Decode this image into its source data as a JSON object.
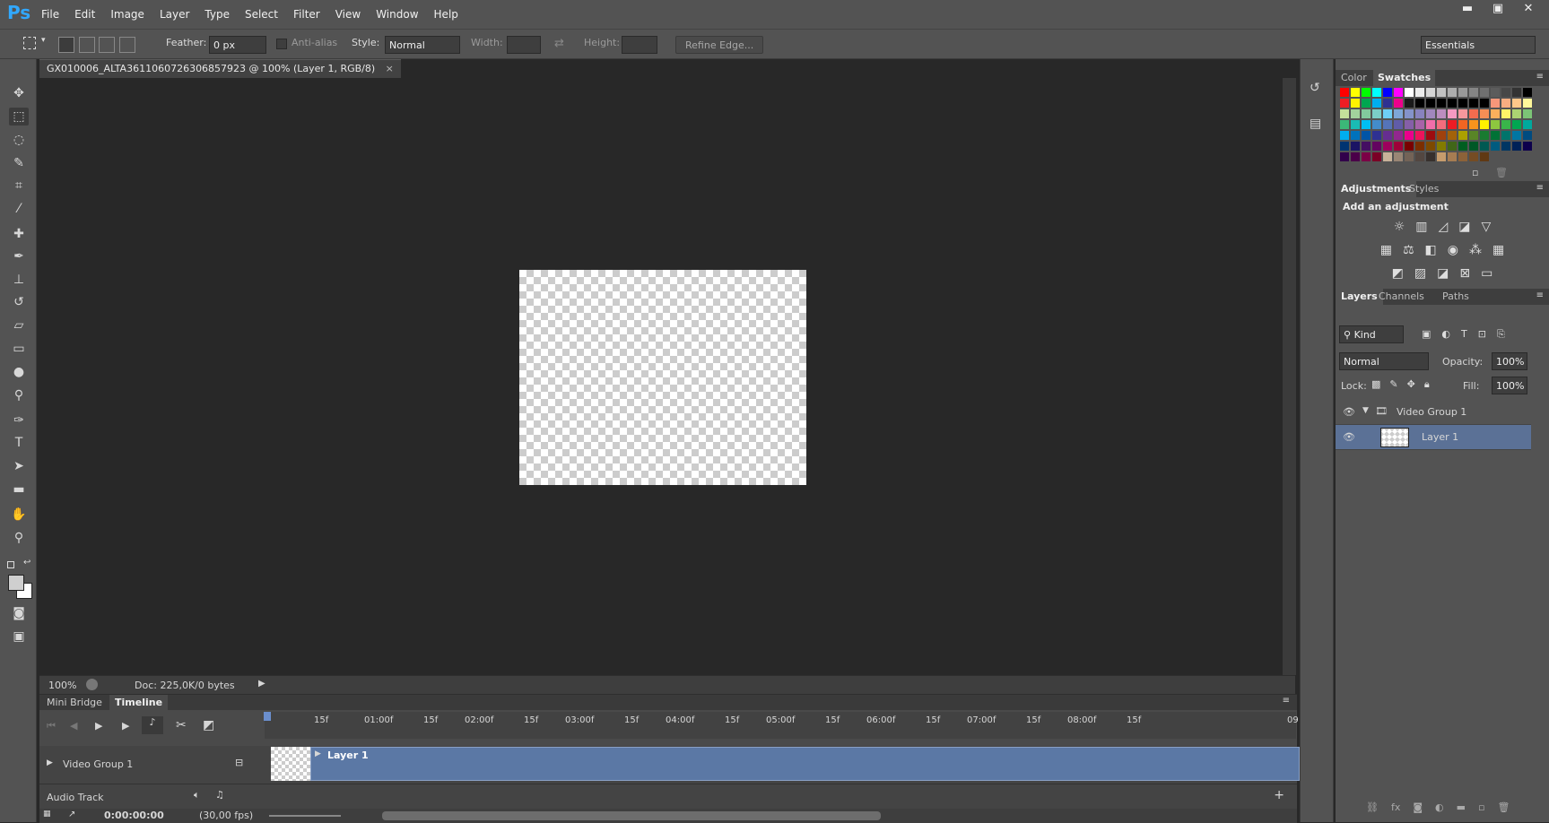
{
  "app": {
    "logo": "Ps"
  },
  "menu": [
    "File",
    "Edit",
    "Image",
    "Layer",
    "Type",
    "Select",
    "Filter",
    "View",
    "Window",
    "Help"
  ],
  "window_controls": {
    "minimize": "▬",
    "maximize": "▣",
    "close": "✕"
  },
  "options": {
    "feather_label": "Feather:",
    "feather_value": "0 px",
    "antialias_label": "Anti-alias",
    "style_label": "Style:",
    "style_value": "Normal",
    "width_label": "Width:",
    "height_label": "Height:",
    "refine_label": "Refine Edge...",
    "workspace": "Essentials"
  },
  "document": {
    "tab_title": "GX010006_ALTA3611060726306857923 @ 100% (Layer 1, RGB/8)",
    "close": "×"
  },
  "status": {
    "zoom": "100%",
    "doc": "Doc: 225,0K/0 bytes"
  },
  "timeline": {
    "tabs": [
      "Mini Bridge",
      "Timeline"
    ],
    "ticks": [
      "15f",
      "01:00f",
      "15f",
      "02:00f",
      "15f",
      "03:00f",
      "15f",
      "04:00f",
      "15f",
      "05:00f",
      "15f",
      "06:00f",
      "15f",
      "07:00f",
      "15f",
      "08:00f",
      "15f",
      "09"
    ],
    "group_name": "Video Group 1",
    "clip_name": "Layer 1",
    "audio_track": "Audio Track",
    "timecode": "0:00:00:00",
    "fps": "(30,00 fps)"
  },
  "panels": {
    "color_tabs": [
      "Color",
      "Swatches"
    ],
    "swatch_colors": [
      "#ff0000",
      "#ffff00",
      "#00ff00",
      "#00ffff",
      "#0000ff",
      "#ff00ff",
      "#ffffff",
      "#ebebeb",
      "#d6d6d6",
      "#c2c2c2",
      "#adadad",
      "#999999",
      "#858585",
      "#707070",
      "#5c5c5c",
      "#474747",
      "#333333",
      "#000000",
      "#ee1d24",
      "#fff200",
      "#00a650",
      "#00aeef",
      "#2e3192",
      "#ec008c",
      "#1a1a1a",
      "#000000",
      "#000000",
      "#000000",
      "#000000",
      "#000000",
      "#000000",
      "#000000",
      "#f7977a",
      "#f9ad81",
      "#fdc68a",
      "#fff79a",
      "#c4df9b",
      "#a2d39c",
      "#82ca9d",
      "#7bcdc8",
      "#6ecff6",
      "#7ea7d8",
      "#8493ca",
      "#8882be",
      "#a187be",
      "#bc8dbf",
      "#f49ac2",
      "#f6989d",
      "#f26c4f",
      "#f68e55",
      "#fbaf5c",
      "#fff467",
      "#acd372",
      "#7cc576",
      "#3bb878",
      "#1abbb4",
      "#00bff3",
      "#438cca",
      "#5574b9",
      "#605ca8",
      "#855fa8",
      "#a763a8",
      "#f06ea9",
      "#f26d7d",
      "#ed1c24",
      "#f26522",
      "#f7941d",
      "#fff200",
      "#8dc73f",
      "#39b54a",
      "#00a651",
      "#00a99d",
      "#00aeef",
      "#0072bc",
      "#0054a6",
      "#2e3192",
      "#662d91",
      "#92278f",
      "#ec008c",
      "#ed145b",
      "#9e0b0f",
      "#a0410d",
      "#a36209",
      "#aba000",
      "#598527",
      "#197b30",
      "#007236",
      "#00746b",
      "#0076a3",
      "#004b80",
      "#003471",
      "#1b1464",
      "#440e62",
      "#630460",
      "#9e005d",
      "#9e0039",
      "#790000",
      "#7b2e00",
      "#7d4900",
      "#827b00",
      "#406618",
      "#005e20",
      "#005826",
      "#005952",
      "#005b7f",
      "#003663",
      "#002157",
      "#0d004c",
      "#32004b",
      "#4b0049",
      "#7b0046",
      "#7a0026",
      "#c7b299",
      "#998675",
      "#736357",
      "#534741",
      "#37302d",
      "#c69c6d",
      "#a67c52",
      "#8c6239",
      "#754c24",
      "#603913"
    ],
    "adjust_tabs": [
      "Adjustments",
      "Styles"
    ],
    "add_adjustment": "Add an adjustment",
    "layers_tabs": [
      "Layers",
      "Channels",
      "Paths"
    ],
    "kind": "Kind",
    "blend_mode": "Normal",
    "opacity_label": "Opacity:",
    "opacity_value": "100%",
    "lock_label": "Lock:",
    "fill_label": "Fill:",
    "fill_value": "100%",
    "layers": [
      {
        "name": "Video Group 1"
      },
      {
        "name": "Layer 1"
      }
    ]
  }
}
